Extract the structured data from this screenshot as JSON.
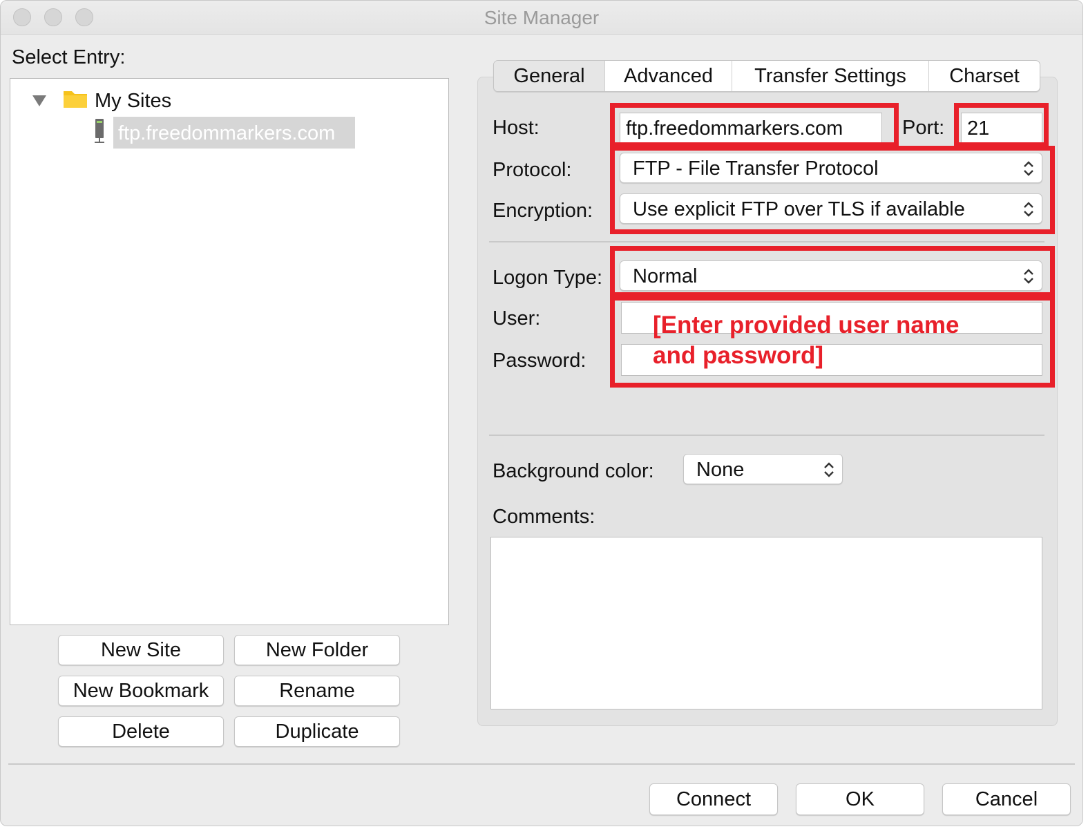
{
  "window": {
    "title": "Site Manager"
  },
  "left": {
    "select_entry_label": "Select Entry:",
    "tree": {
      "folder_label": "My Sites",
      "site_label": "ftp.freedommarkers.com"
    },
    "buttons": {
      "new_site": "New Site",
      "new_folder": "New Folder",
      "new_bookmark": "New Bookmark",
      "rename": "Rename",
      "delete": "Delete",
      "duplicate": "Duplicate"
    }
  },
  "tabs": [
    "General",
    "Advanced",
    "Transfer Settings",
    "Charset"
  ],
  "general": {
    "host_label": "Host:",
    "host_value": "ftp.freedommarkers.com",
    "port_label": "Port:",
    "port_value": "21",
    "protocol_label": "Protocol:",
    "protocol_value": "FTP - File Transfer Protocol",
    "encryption_label": "Encryption:",
    "encryption_value": "Use explicit FTP over TLS if available",
    "logon_type_label": "Logon Type:",
    "logon_type_value": "Normal",
    "user_label": "User:",
    "password_label": "Password:",
    "background_color_label": "Background color:",
    "background_color_value": "None",
    "comments_label": "Comments:"
  },
  "annotation": {
    "line1": "[Enter provided user name",
    "line2": "and password]",
    "color": "#e8202a"
  },
  "footer": {
    "connect": "Connect",
    "ok": "OK",
    "cancel": "Cancel"
  }
}
